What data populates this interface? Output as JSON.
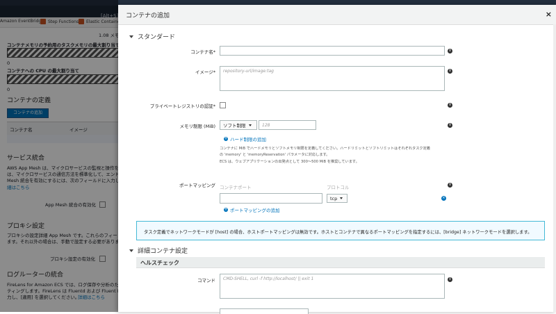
{
  "browser": {
    "shortcut_hint": "[Alt+S]"
  },
  "bookmarks": [
    {
      "label": "Amazon EventBridge"
    },
    {
      "label": "Step Functions"
    },
    {
      "label": "Elastic Container Re"
    }
  ],
  "left_panel": {
    "memory_value": "1.08 メモ",
    "task_memory_label": "コンテナメモリの予約用のタスクメモリの最大割り当て",
    "task_memory_zero": "0",
    "cpu_label": "コンテナへの CPU の最大割り当て",
    "cpu_zero": "0",
    "container_def_title": "コンテナの定義",
    "add_container_button": "コンテナの追加",
    "table_headers": [
      "コンテナ名",
      "イメージ"
    ],
    "service_integration_title": "サービス統合",
    "service_integration_text": [
      "AWS App Mesh は、マイクロサービスの監視と操作を容",
      "は、マイクロサービスの通信方法を標準化して、エンド",
      "Mesh 統合を有効にするには、次のフィールドに入力し"
    ],
    "learn_more": "細はこちら",
    "app_mesh_label": "App Mesh 統合の有効化",
    "proxy_title": "プロキシ設定",
    "proxy_text": [
      "プロキシの設定詳細 App Mesh です。これらのフィー",
      "ます。それ以外の場合は、手動で設定する必要がありま"
    ],
    "proxy_enable_label": "プロキシ設定の有効化",
    "log_router_title": "ログルーターの統合",
    "log_router_text": [
      "FireLens for Amazon ECS では、ログ保存や分析のため",
      "ティングします。FireLens は Fluentd および Fluent Bit",
      "力し、[適用] を選択してください。"
    ],
    "log_router_link": "詳細はこちら"
  },
  "modal": {
    "title": "コンテナの追加",
    "close": "×",
    "standard_section": "スタンダード",
    "container_name_label": "コンテナ名*",
    "container_name_value": "",
    "image_label": "イメージ*",
    "image_placeholder": "repository-url/image:tag",
    "private_registry_label": "プライベートレジストリの認証*",
    "memory_limit_label": "メモリ制限 (MiB)",
    "memory_select": "ソフト制限",
    "memory_placeholder": "128",
    "add_hard_limit": "ハード制限の追加",
    "memory_help": [
      "コンテナに MiB でハードメモリとソフトメモリ制限を定義してください。ハードリミットとソフトリミットはそれぞれタスク定義",
      "の 'memory' と 'memoryReservation' パラメータに対応します。",
      "ECS は、ウェブアプリケーションの出発点として 300～500 MiB を推奨しています。"
    ],
    "port_mapping_label": "ポートマッピング",
    "container_port_header": "コンテナポート",
    "protocol_header": "プロトコル",
    "protocol_value": "tcp",
    "add_port_mapping": "ポートマッピングの追加",
    "notice": "タスク定義でネットワークモードが [host] の場合、ホストポートマッピングは無効です。ホストとコンテナで異なるポートマッピングを指定するには、[bridge] ネットワークモードを選択します。",
    "advanced_section": "詳細コンテナ設定",
    "healthcheck_title": "ヘルスチェック",
    "command_label": "コマンド",
    "command_placeholder": "CMD-SHELL, curl -f http://localhost/ || exit 1"
  }
}
